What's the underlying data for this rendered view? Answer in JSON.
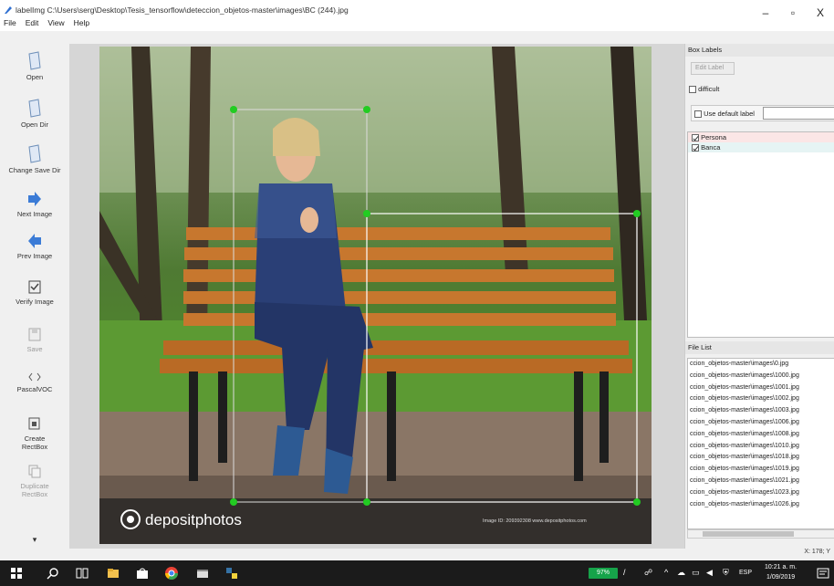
{
  "window": {
    "title": "labelImg C:\\Users\\serg\\Desktop\\Tesis_tensorflow\\deteccion_objetos-master\\images\\BC (244).jpg",
    "controls": {
      "minimize": "–",
      "maximize": "▫",
      "close": "X"
    }
  },
  "menu": {
    "file": "File",
    "edit": "Edit",
    "view": "View",
    "help": "Help"
  },
  "toolbar": {
    "open": "Open",
    "open_dir": "Open Dir",
    "change_save_dir": "Change Save Dir",
    "next_image": "Next Image",
    "prev_image": "Prev Image",
    "verify_image": "Verify Image",
    "save": "Save",
    "format": "PascalVOC",
    "create_rectbox": "Create\nRectBox",
    "duplicate_rectbox": "Duplicate\nRectBox"
  },
  "image": {
    "watermark": "depositphotos",
    "footer_small": "Image ID: 209392308    www.depositphotos.com"
  },
  "box_labels": {
    "title": "Box Labels",
    "edit_label_button": "Edit Label",
    "difficult": "difficult",
    "use_default_label": "Use default label",
    "default_label_value": "",
    "labels": [
      {
        "name": "Persona",
        "checked": true
      },
      {
        "name": "Banca",
        "checked": true
      }
    ]
  },
  "file_list": {
    "title": "File List",
    "items": [
      "ccion_objetos-master\\images\\0.jpg",
      "ccion_objetos-master\\images\\1000.jpg",
      "ccion_objetos-master\\images\\1001.jpg",
      "ccion_objetos-master\\images\\1002.jpg",
      "ccion_objetos-master\\images\\1003.jpg",
      "ccion_objetos-master\\images\\1006.jpg",
      "ccion_objetos-master\\images\\1008.jpg",
      "ccion_objetos-master\\images\\1010.jpg",
      "ccion_objetos-master\\images\\1018.jpg",
      "ccion_objetos-master\\images\\1019.jpg",
      "ccion_objetos-master\\images\\1021.jpg",
      "ccion_objetos-master\\images\\1023.jpg",
      "ccion_objetos-master\\images\\1026.jpg"
    ]
  },
  "status": {
    "coords": "X: 178; Y"
  },
  "taskbar": {
    "battery": "97%",
    "language": "ESP",
    "time": "10:21 a. m.",
    "date": "1/09/2019"
  },
  "colors": {
    "box_person": "#d6d6d6",
    "box_bench": "#ffffff",
    "handle": "#22cc22",
    "taskbar": "#1b1b1b",
    "battery": "#16a34a"
  }
}
